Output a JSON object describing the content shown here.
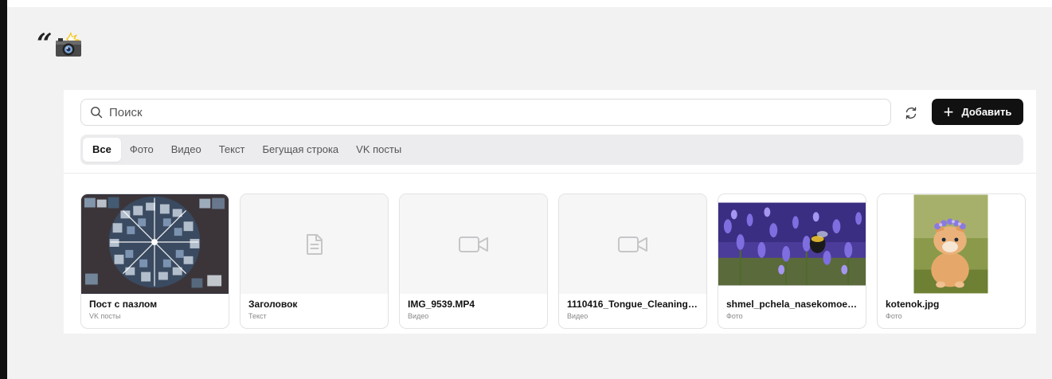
{
  "header": {
    "quote_icon": "quote-icon",
    "emoji_icon": "camera-flash-icon"
  },
  "search": {
    "placeholder": "Поиск",
    "value": ""
  },
  "toolbar": {
    "refresh_icon": "refresh-icon",
    "add_label": "Добавить"
  },
  "tabs": [
    {
      "label": "Все",
      "active": true
    },
    {
      "label": "Фото",
      "active": false
    },
    {
      "label": "Видео",
      "active": false
    },
    {
      "label": "Текст",
      "active": false
    },
    {
      "label": "Бегущая строка",
      "active": false
    },
    {
      "label": "VK посты",
      "active": false
    }
  ],
  "cards": [
    {
      "title": "Пост с пазлом",
      "type": "VK посты",
      "thumb": "puzzle-collage-image"
    },
    {
      "title": "Заголовок",
      "type": "Текст",
      "thumb": "document-icon"
    },
    {
      "title": "IMG_9539.MP4",
      "type": "Видео",
      "thumb": "video-camera-icon"
    },
    {
      "title": "1110416_Tongue_Cleaning_1...",
      "type": "Видео",
      "thumb": "video-camera-icon"
    },
    {
      "title": "shmel_pchela_nasekomoe_...",
      "type": "Фото",
      "thumb": "bumblebee-photo"
    },
    {
      "title": "kotenok.jpg",
      "type": "Фото",
      "thumb": "kitten-photo"
    }
  ],
  "colors": {
    "primary_button": "#111111",
    "page_bg": "#f2f2f2",
    "tabs_bg": "#ececef"
  }
}
